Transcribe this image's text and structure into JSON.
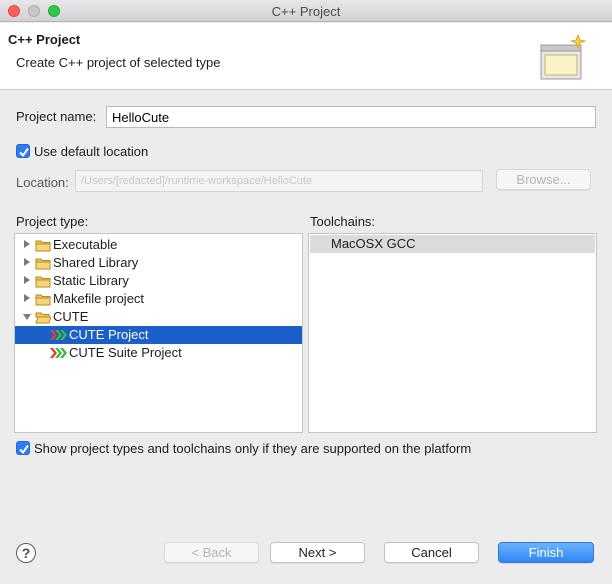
{
  "window": {
    "title": "C++ Project"
  },
  "header": {
    "title": "C++ Project",
    "description": "Create C++ project of selected type"
  },
  "project_name": {
    "label": "Project name:",
    "value": "HelloCute"
  },
  "default_location": {
    "label": "Use default location",
    "checked": true
  },
  "location": {
    "label": "Location:",
    "value": "/Users/[redacted]/runtime-workspace/HelloCute",
    "browse_label": "Browse..."
  },
  "project_type": {
    "label": "Project type:",
    "items": [
      {
        "label": "Executable",
        "expanded": false,
        "kind": "folder"
      },
      {
        "label": "Shared Library",
        "expanded": false,
        "kind": "folder"
      },
      {
        "label": "Static Library",
        "expanded": false,
        "kind": "folder"
      },
      {
        "label": "Makefile project",
        "expanded": false,
        "kind": "folder"
      },
      {
        "label": "CUTE",
        "expanded": true,
        "kind": "folder"
      },
      {
        "label": "CUTE Project",
        "kind": "cute",
        "selected": true
      },
      {
        "label": "CUTE Suite Project",
        "kind": "cute",
        "selected": false
      }
    ]
  },
  "toolchains": {
    "label": "Toolchains:",
    "items": [
      {
        "label": "MacOSX GCC",
        "selected": true
      }
    ]
  },
  "show_supported": {
    "label": "Show project types and toolchains only if they are supported on the platform",
    "checked": true
  },
  "buttons": {
    "back": "< Back",
    "next": "Next >",
    "cancel": "Cancel",
    "finish": "Finish"
  },
  "colors": {
    "accent": "#2e86f5",
    "selection": "#1b5fc8"
  }
}
